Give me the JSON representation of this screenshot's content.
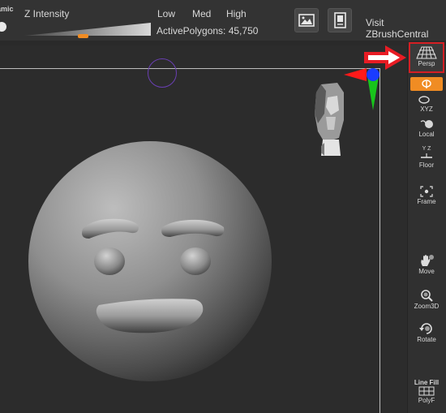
{
  "toolbar": {
    "dynamic_partial": "amic",
    "z_intensity_label": "Z Intensity",
    "z_intensity_level": 0.47,
    "low_label": "Low",
    "med_label": "Med",
    "high_label": "High",
    "active_polygons": "ActivePolygons: 45,750",
    "image_icon": "picture-icon",
    "document_icon": "document-icon",
    "visit_label": "Visit ZBrushCentral"
  },
  "shelf": {
    "persp_label": "Persp",
    "xyz_label": "XYZ",
    "local_label": "Local",
    "floor_label": "Floor",
    "floor_axes": "Y Z",
    "frame_label": "Frame",
    "move_label": "Move",
    "zoom_label": "Zoom3D",
    "rotate_label": "Rotate",
    "line_fill_label": "Line Fill",
    "polyf_label": "PolyF"
  },
  "viewport": {
    "gizmo_colors": {
      "x": "#ff1a1a",
      "y": "#18c51b",
      "z": "#1a3cff"
    }
  },
  "accent": {
    "brand": "#f08c23",
    "highlight": "#d41f24"
  }
}
